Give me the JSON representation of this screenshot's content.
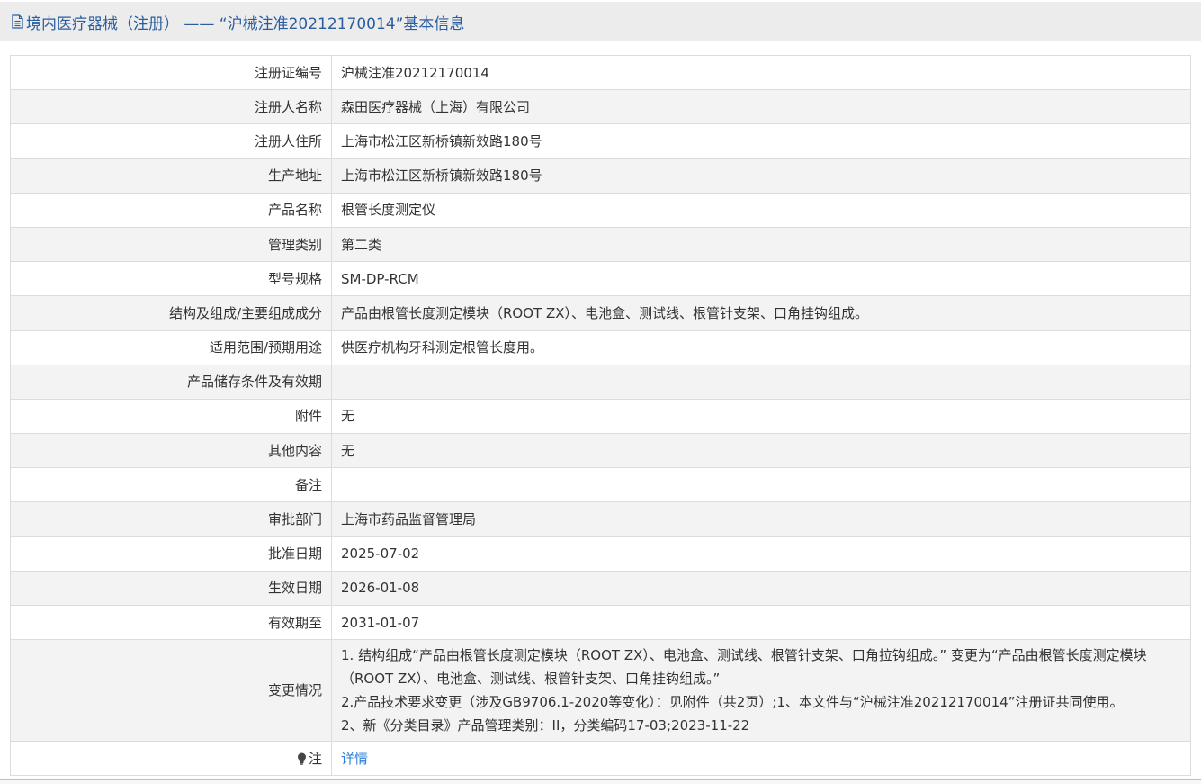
{
  "header": {
    "icon": "document-icon",
    "title": "境内医疗器械（注册） —— “沪械注准20212170014”基本信息",
    "accent_color": "#2a5d9f"
  },
  "rows": [
    {
      "label": "注册证编号",
      "value": "沪械注准20212170014"
    },
    {
      "label": "注册人名称",
      "value": "森田医疗器械（上海）有限公司"
    },
    {
      "label": "注册人住所",
      "value": "上海市松江区新桥镇新效路180号"
    },
    {
      "label": "生产地址",
      "value": "上海市松江区新桥镇新效路180号"
    },
    {
      "label": "产品名称",
      "value": "根管长度测定仪"
    },
    {
      "label": "管理类别",
      "value": "第二类"
    },
    {
      "label": "型号规格",
      "value": "SM-DP-RCM"
    },
    {
      "label": "结构及组成/主要组成成分",
      "value": "产品由根管长度测定模块（ROOT ZX）、电池盒、测试线、根管针支架、口角挂钩组成。"
    },
    {
      "label": "适用范围/预期用途",
      "value": "供医疗机构牙科测定根管长度用。"
    },
    {
      "label": "产品储存条件及有效期",
      "value": ""
    },
    {
      "label": "附件",
      "value": "无"
    },
    {
      "label": "其他内容",
      "value": "无"
    },
    {
      "label": "备注",
      "value": ""
    },
    {
      "label": "审批部门",
      "value": "上海市药品监督管理局"
    },
    {
      "label": "批准日期",
      "value": "2025-07-02"
    },
    {
      "label": "生效日期",
      "value": "2026-01-08"
    },
    {
      "label": "有效期至",
      "value": "2031-01-07"
    }
  ],
  "change": {
    "label": "变更情况",
    "line1": "1. 结构组成“产品由根管长度测定模块（ROOT ZX）、电池盒、测试线、根管针支架、口角拉钩组成。” 变更为“产品由根管长度测定模块（ROOT ZX）、电池盒、测试线、根管针支架、口角挂钩组成。”",
    "line2": "2.产品技术要求变更（涉及GB9706.1-2020等变化）：见附件（共2页）;1、本文件与“沪械注准20212170014”注册证共同使用。",
    "line3": "2、新《分类目录》产品管理类别：II，分类编码17-03;2023-11-22"
  },
  "note": {
    "icon": "lightbulb-icon",
    "label": "注",
    "link_text": "详情",
    "link_color": "#2a7fd4"
  }
}
